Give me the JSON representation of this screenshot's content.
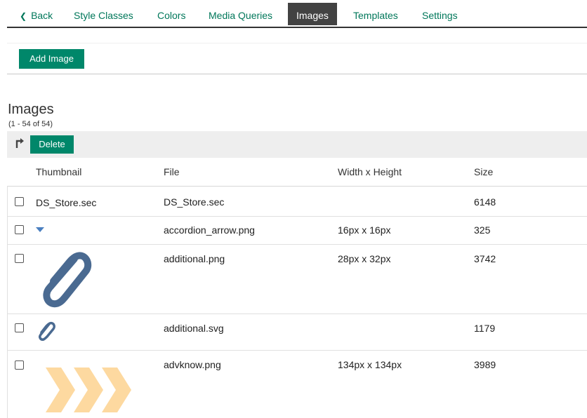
{
  "nav": {
    "back": "Back",
    "tabs": [
      "Style Classes",
      "Colors",
      "Media Queries",
      "Images",
      "Templates",
      "Settings"
    ]
  },
  "actions": {
    "add_image": "Add Image"
  },
  "section": {
    "title": "Images",
    "count": "(1 - 54 of 54)"
  },
  "toolbar": {
    "delete": "Delete"
  },
  "table": {
    "headers": [
      "Thumbnail",
      "File",
      "Width x Height",
      "Size"
    ],
    "rows": [
      {
        "thumbnail_text": "DS_Store.sec",
        "file": "DS_Store.sec",
        "dims": "",
        "size": "6148"
      },
      {
        "file": "accordion_arrow.png",
        "dims": "16px x 16px",
        "size": "325"
      },
      {
        "file": "additional.png",
        "dims": "28px x 32px",
        "size": "3742"
      },
      {
        "file": "additional.svg",
        "dims": "",
        "size": "1179"
      },
      {
        "file": "advknow.png",
        "dims": "134px x 134px",
        "size": "3989"
      }
    ]
  },
  "colors": {
    "accent": "#00876a",
    "active_tab": "#424242",
    "paperclip": "#4a6a91",
    "chevron": "#fdd9a0"
  }
}
